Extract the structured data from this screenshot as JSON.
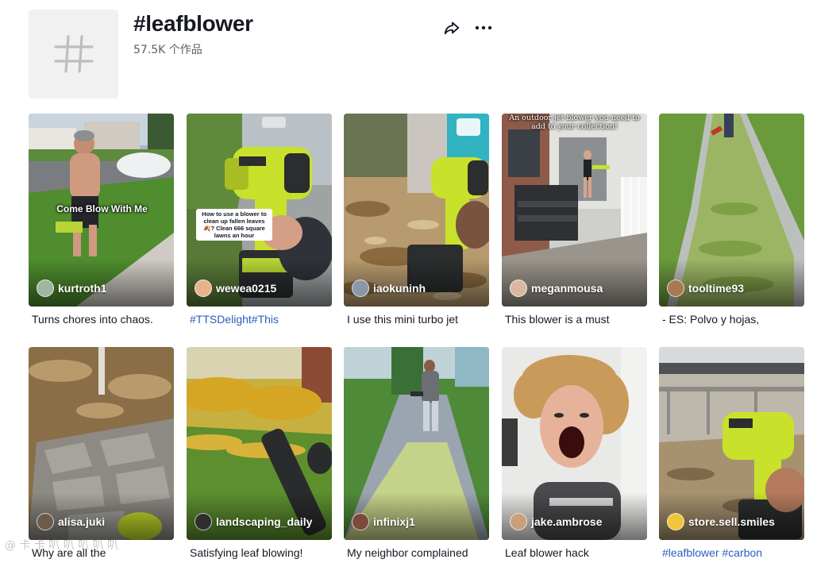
{
  "header": {
    "title": "#leafblower",
    "count_text": "57.5K 个作品"
  },
  "icons": {
    "hashtag": "hashtag-icon",
    "share": "share-icon",
    "more": "more-options-icon"
  },
  "colors": {
    "link": "#2b5db9",
    "text": "#161823",
    "secondary": "#5d5e66"
  },
  "videos": [
    {
      "username": "kurtroth1",
      "caption": "Turns chores into chaos.",
      "overlay": "Come Blow With Me"
    },
    {
      "username": "wewea0215",
      "caption": "#TTSDelight#This",
      "overlay": "How to use a blower to clean up fallen leaves 🍂? Clean 666 square lawns an hour"
    },
    {
      "username": "iaokuninh",
      "caption": "I use this mini turbo jet",
      "overlay": ""
    },
    {
      "username": "meganmousa",
      "caption": "This blower is a must",
      "overlay": "An outdoor jet blower you need to add to your collection!"
    },
    {
      "username": "tooltime93",
      "caption": "- ES: Polvo y hojas,",
      "overlay": ""
    },
    {
      "username": "alisa.juki",
      "caption": "Why are all the",
      "overlay": ""
    },
    {
      "username": "landscaping_daily",
      "caption": "Satisfying leaf blowing!",
      "overlay": ""
    },
    {
      "username": "infinixj1",
      "caption": "My neighbor complained",
      "overlay": ""
    },
    {
      "username": "jake.ambrose",
      "caption": "Leaf blower hack",
      "overlay": ""
    },
    {
      "username": "store.sell.smiles",
      "caption": "#leafblower #carbon",
      "overlay": ""
    }
  ],
  "watermark": "@ 卡 卡 叭 叭 叭 叭 叭"
}
